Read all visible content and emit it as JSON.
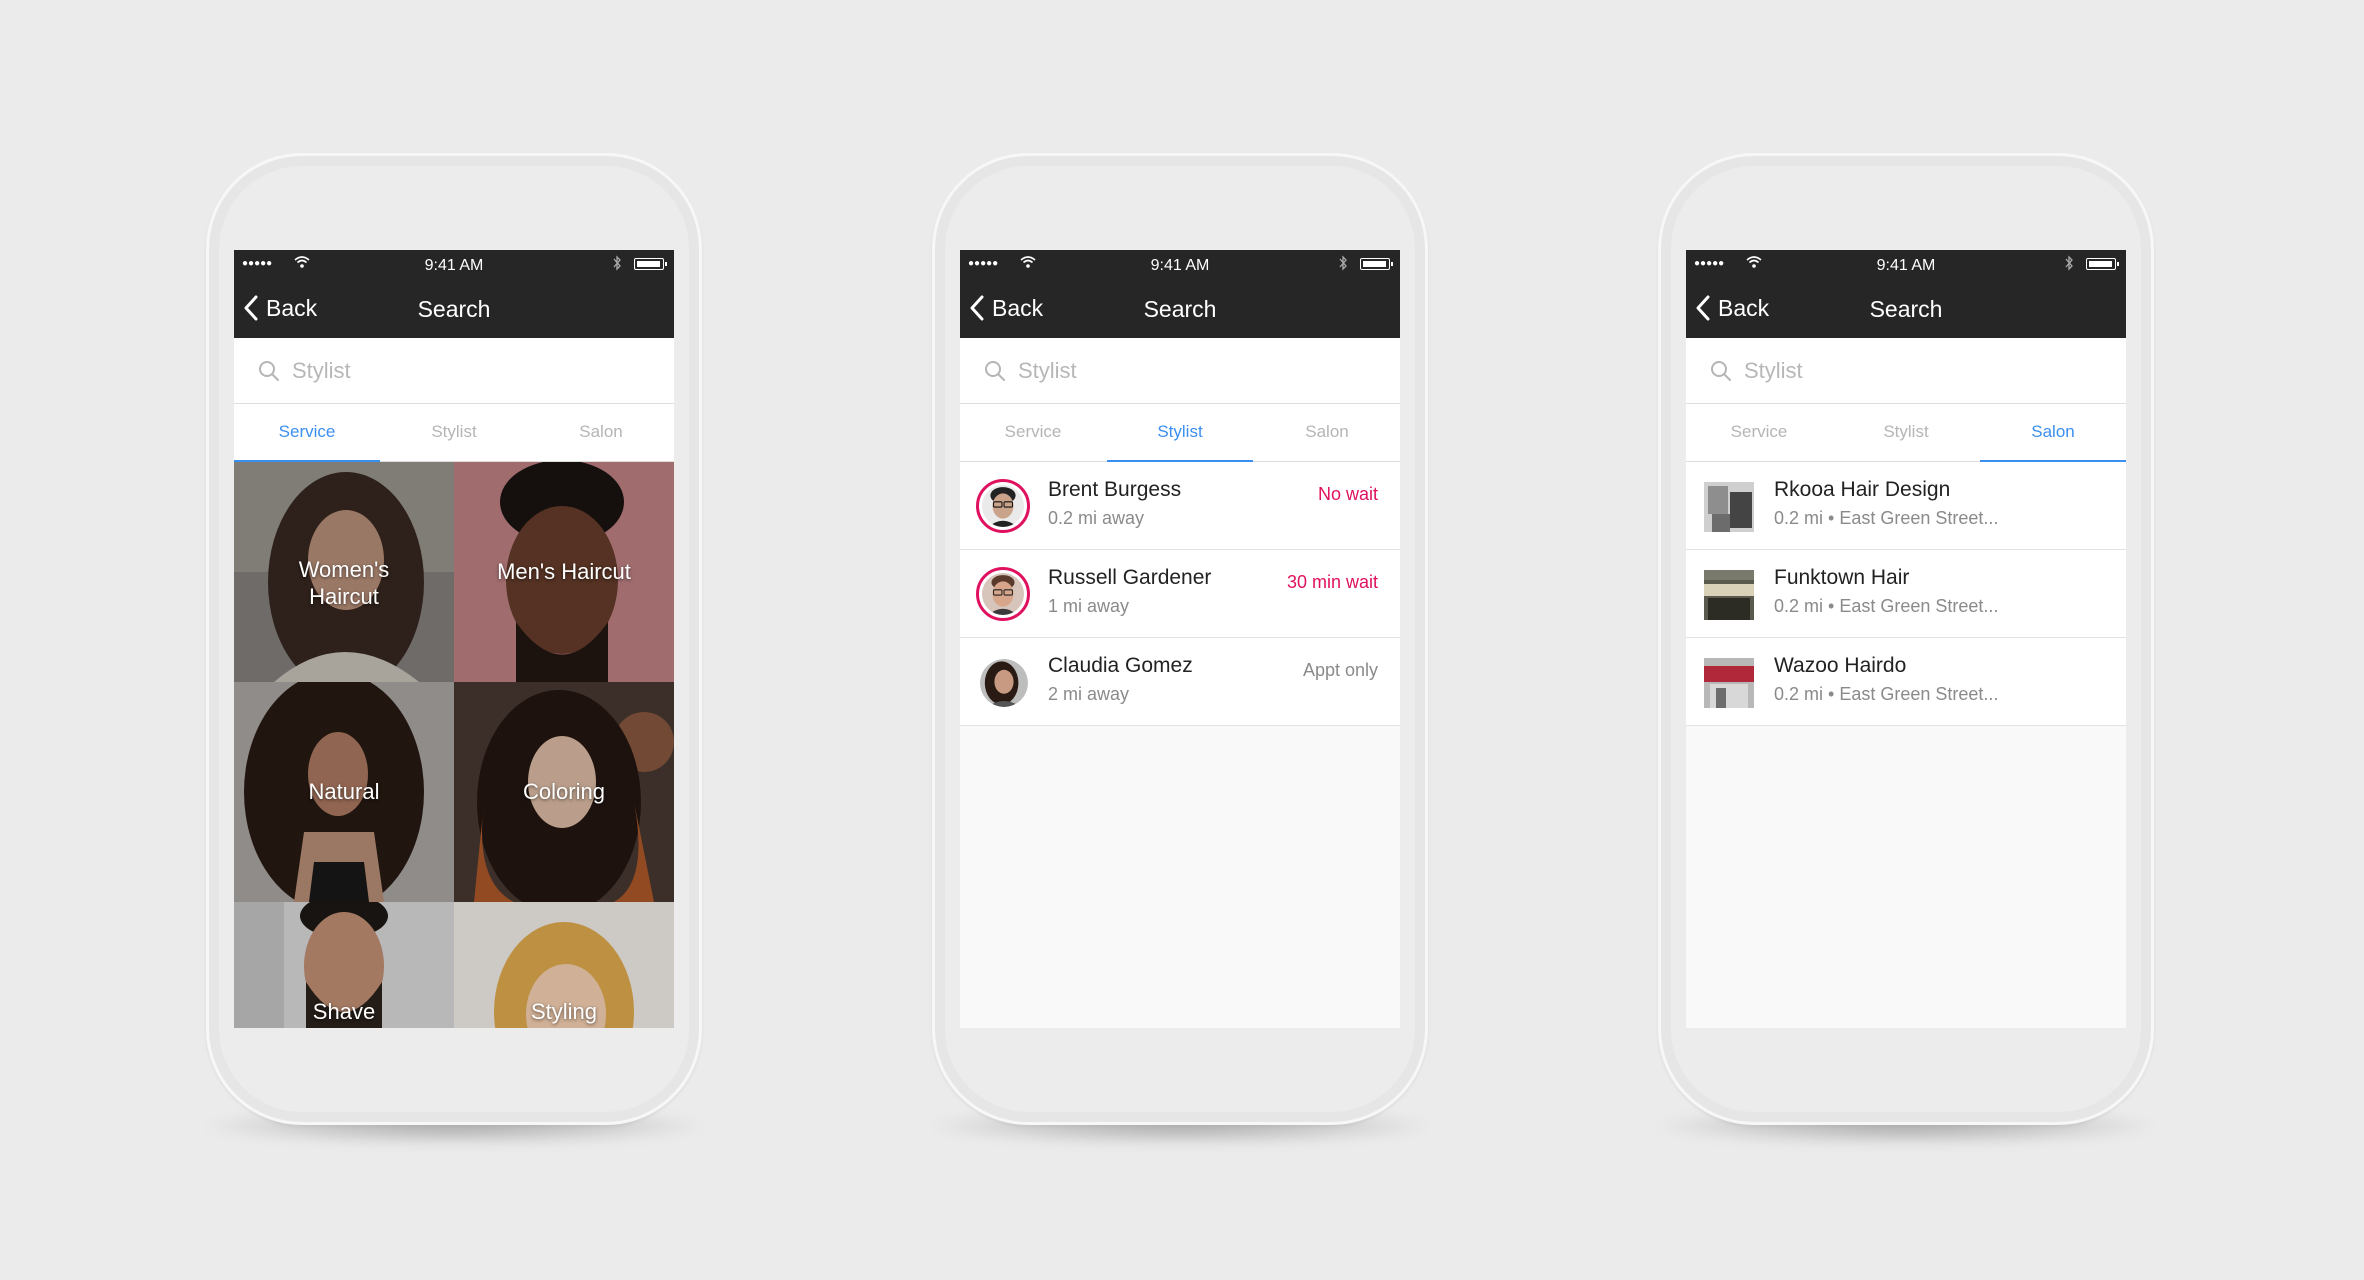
{
  "status_bar": {
    "signal": "●●●●●",
    "time": "9:41 AM"
  },
  "nav": {
    "back_label": "Back",
    "title": "Search"
  },
  "search": {
    "placeholder": "Stylist",
    "value": ""
  },
  "tabs": [
    "Service",
    "Stylist",
    "Salon"
  ],
  "accent_color": "#3b8ff0",
  "alert_color": "#e0115f",
  "screens": [
    {
      "active_tab": "Service",
      "services": [
        {
          "label": "Women's Haircut",
          "label_lines": [
            "Women's",
            "Haircut"
          ]
        },
        {
          "label": "Men's Haircut",
          "label_lines": [
            "Men's Haircut"
          ]
        },
        {
          "label": "Natural",
          "label_lines": [
            "Natural"
          ]
        },
        {
          "label": "Coloring",
          "label_lines": [
            "Coloring"
          ]
        },
        {
          "label": "Shave",
          "label_lines": [
            "Shave"
          ]
        },
        {
          "label": "Styling",
          "label_lines": [
            "Styling"
          ]
        }
      ]
    },
    {
      "active_tab": "Stylist",
      "stylists": [
        {
          "name": "Brent Burgess",
          "distance": "0.2 mi away",
          "status": "No wait",
          "status_color": "#e0115f",
          "avatar_icon": "stylist-avatar"
        },
        {
          "name": "Russell Gardener",
          "distance": "1 mi away",
          "status": "30 min wait",
          "status_color": "#e0115f",
          "avatar_icon": "stylist-avatar"
        },
        {
          "name": "Claudia Gomez",
          "distance": "2 mi away",
          "status": "Appt only",
          "status_color": "#8a8a8a",
          "avatar_icon": "stylist-avatar"
        }
      ]
    },
    {
      "active_tab": "Salon",
      "salons": [
        {
          "name": "Rkooa Hair Design",
          "details": "0.2 mi • East Green Street..."
        },
        {
          "name": "Funktown Hair",
          "details": "0.2 mi • East Green Street..."
        },
        {
          "name": "Wazoo Hairdo",
          "details": "0.2 mi • East Green Street..."
        }
      ]
    }
  ]
}
